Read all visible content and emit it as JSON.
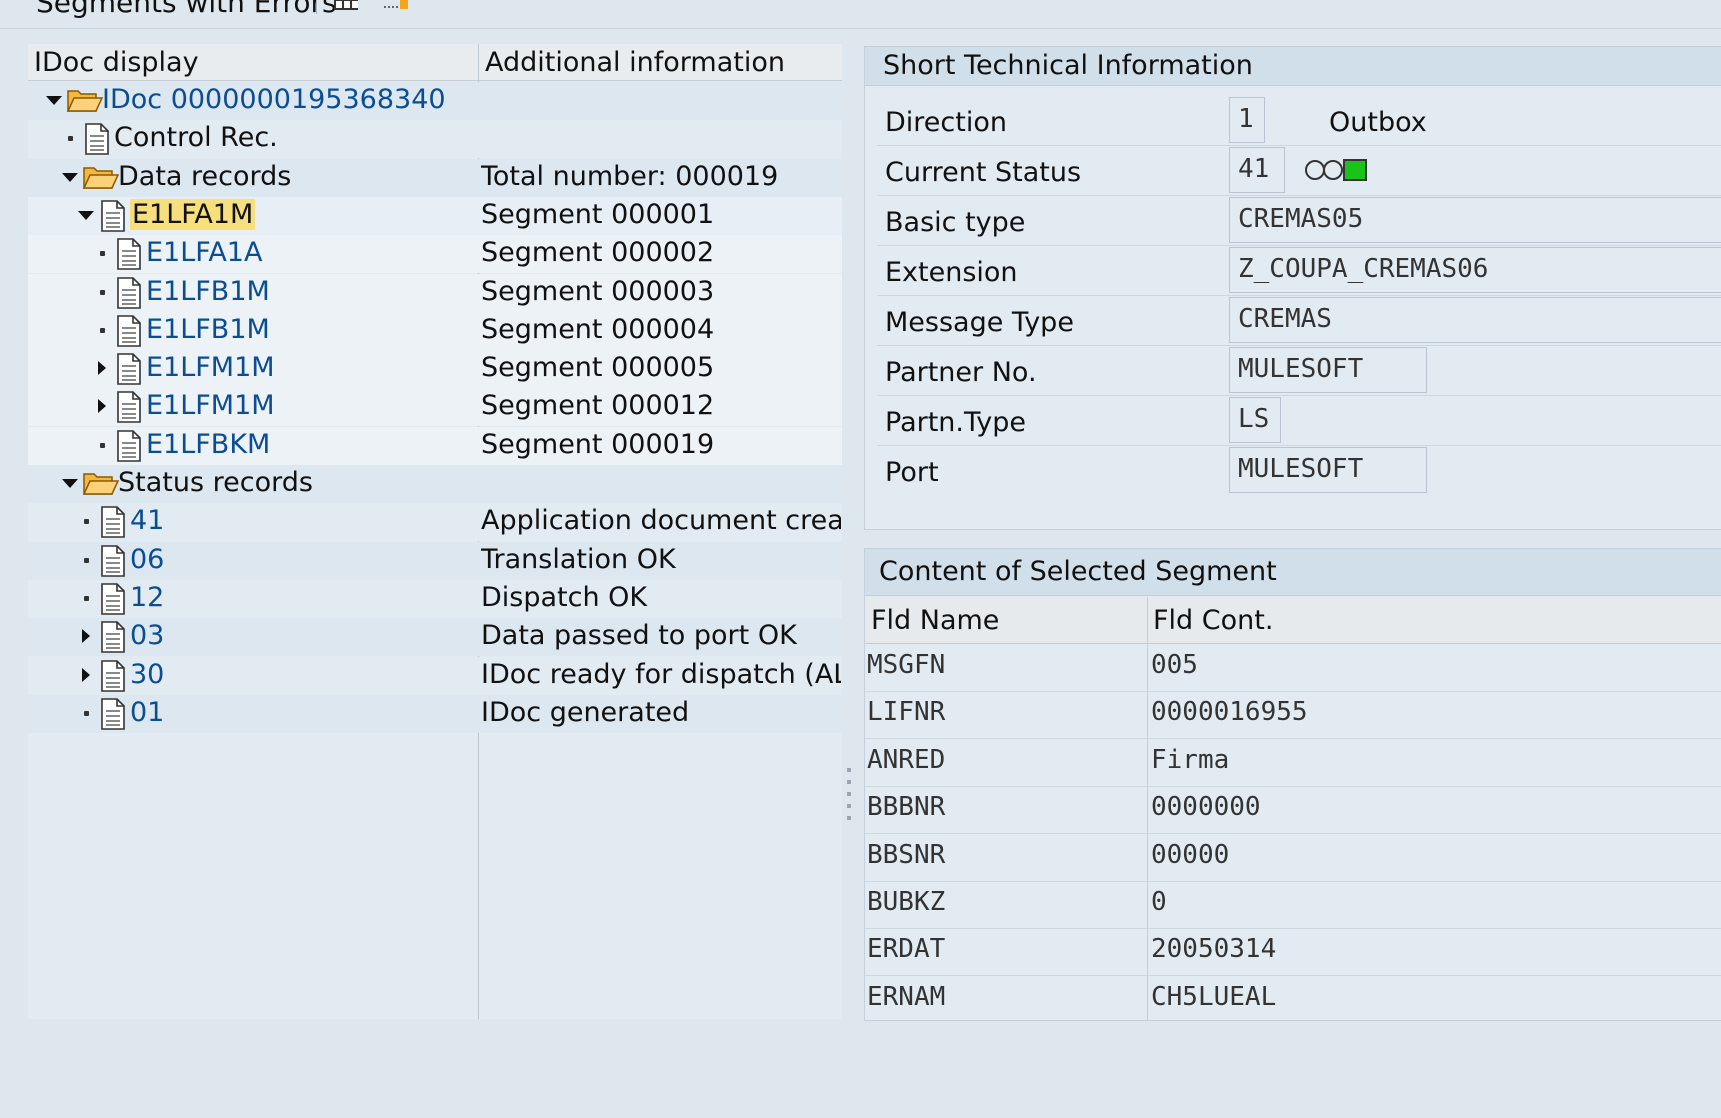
{
  "toolbar": {
    "title": "Segments with Errors"
  },
  "tree": {
    "col1": "IDoc display",
    "col2": "Additional information",
    "rows": [
      {
        "label": "IDoc 0000000195368340",
        "info": "",
        "expander": "down",
        "icon": "folder",
        "indent": 0,
        "color": "blue"
      },
      {
        "label": "Control Rec.",
        "info": "",
        "expander": "dot",
        "icon": "doc",
        "indent": 1,
        "color": "black"
      },
      {
        "label": "Data records",
        "info": "Total number: 000019",
        "expander": "down",
        "icon": "folder",
        "indent": 1,
        "color": "black"
      },
      {
        "label": "E1LFA1M",
        "info": "Segment 000001",
        "expander": "down",
        "icon": "doc",
        "indent": 2,
        "color": "black",
        "selected": true
      },
      {
        "label": "E1LFA1A",
        "info": "Segment 000002",
        "expander": "dot",
        "icon": "doc",
        "indent": 3,
        "color": "blue"
      },
      {
        "label": "E1LFB1M",
        "info": "Segment 000003",
        "expander": "dot",
        "icon": "doc",
        "indent": 3,
        "color": "blue"
      },
      {
        "label": "E1LFB1M",
        "info": "Segment 000004",
        "expander": "dot",
        "icon": "doc",
        "indent": 3,
        "color": "blue"
      },
      {
        "label": "E1LFM1M",
        "info": "Segment 000005",
        "expander": "right",
        "icon": "doc",
        "indent": 3,
        "color": "blue"
      },
      {
        "label": "E1LFM1M",
        "info": "Segment 000012",
        "expander": "right",
        "icon": "doc",
        "indent": 3,
        "color": "blue"
      },
      {
        "label": "E1LFBKM",
        "info": "Segment 000019",
        "expander": "dot",
        "icon": "doc",
        "indent": 3,
        "color": "blue"
      },
      {
        "label": "Status records",
        "info": "",
        "expander": "down",
        "icon": "folder",
        "indent": 1,
        "color": "black"
      },
      {
        "label": "41",
        "info": "Application document created",
        "expander": "dot",
        "icon": "doc",
        "indent": 2,
        "color": "blue"
      },
      {
        "label": "06",
        "info": "Translation OK",
        "expander": "dot",
        "icon": "doc",
        "indent": 2,
        "color": "blue"
      },
      {
        "label": "12",
        "info": "Dispatch OK",
        "expander": "dot",
        "icon": "doc",
        "indent": 2,
        "color": "blue"
      },
      {
        "label": "03",
        "info": "Data passed to port OK",
        "expander": "right",
        "icon": "doc",
        "indent": 2,
        "color": "blue"
      },
      {
        "label": "30",
        "info": "IDoc ready for dispatch (ALE s",
        "expander": "right",
        "icon": "doc",
        "indent": 2,
        "color": "blue"
      },
      {
        "label": "01",
        "info": "IDoc generated",
        "expander": "dot",
        "icon": "doc",
        "indent": 2,
        "color": "blue"
      }
    ]
  },
  "tech_info": {
    "title": "Short Technical Information",
    "direction": {
      "label": "Direction",
      "value": "1",
      "text": "Outbox"
    },
    "status": {
      "label": "Current Status",
      "value": "41"
    },
    "basic_type": {
      "label": "Basic type",
      "value": "CREMAS05"
    },
    "extension": {
      "label": "Extension",
      "value": "Z_COUPA_CREMAS06"
    },
    "message_type": {
      "label": "Message Type",
      "value": "CREMAS"
    },
    "partner_no": {
      "label": "Partner No.",
      "value": "MULESOFT"
    },
    "partner_type": {
      "label": "Partn.Type",
      "value": "LS"
    },
    "port": {
      "label": "Port",
      "value": "MULESOFT"
    }
  },
  "segment": {
    "title": "Content of Selected Segment",
    "col1": "Fld Name",
    "col2": "Fld Cont.",
    "rows": [
      {
        "name": "MSGFN",
        "value": "005"
      },
      {
        "name": "LIFNR",
        "value": "0000016955"
      },
      {
        "name": "ANRED",
        "value": "Firma"
      },
      {
        "name": "BBBNR",
        "value": "0000000"
      },
      {
        "name": "BBSNR",
        "value": "00000"
      },
      {
        "name": "BUBKZ",
        "value": "0"
      },
      {
        "name": "ERDAT",
        "value": "20050314"
      },
      {
        "name": "ERNAM",
        "value": "CH5LUEAL"
      }
    ]
  },
  "colors": {
    "selected": "#f7df7d",
    "link": "#0b4d92",
    "status_green": "#19c419"
  }
}
